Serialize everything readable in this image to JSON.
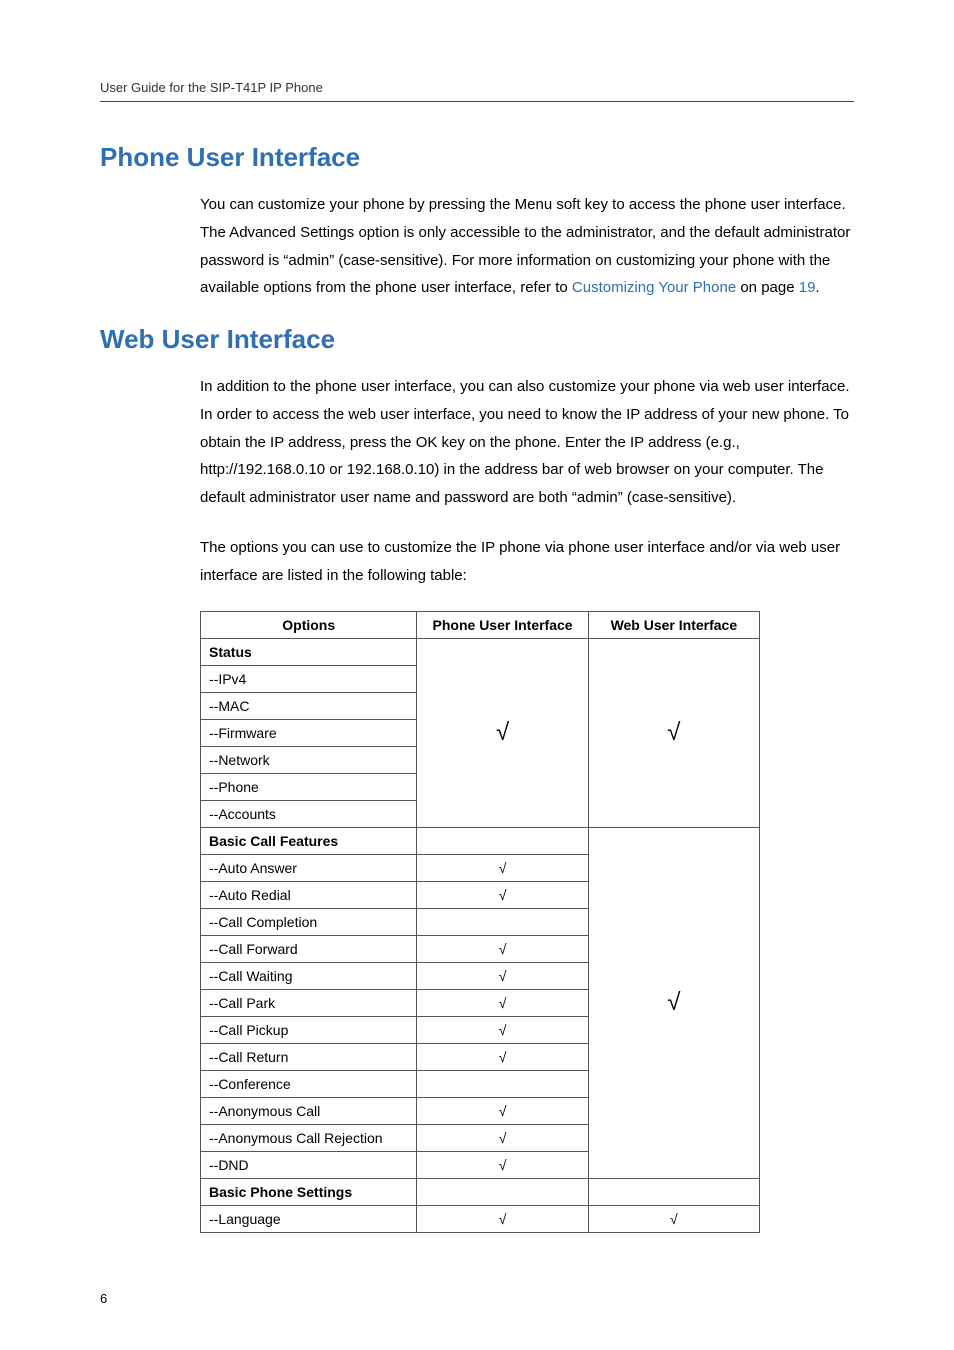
{
  "running_head": "User Guide for the SIP-T41P IP Phone",
  "page_number": "6",
  "sections": {
    "phone_ui": {
      "heading": "Phone User Interface",
      "para": "You can customize your phone by pressing the Menu soft key to access the phone user interface. The Advanced Settings option is only accessible to the administrator, and the default administrator password is “admin” (case-sensitive). For more information on customizing your phone with the available options from the phone user interface, refer to ",
      "link_text": "Customizing Your Phone",
      "para_mid": " on page ",
      "page_ref": "19",
      "para_end": "."
    },
    "web_ui": {
      "heading": "Web User Interface",
      "para1": "In addition to the phone user interface, you can also customize your phone via web user interface. In order to access the web user interface, you need to know the IP address of your new phone. To obtain the IP address, press the OK key on the phone. Enter the IP address (e.g., http://192.168.0.10 or 192.168.0.10) in the address bar of web browser on your computer. The default administrator user name and password are both “admin” (case-sensitive).",
      "para2": "The options you can use to customize the IP phone via phone user interface and/or via web user interface are listed in the following table:"
    }
  },
  "table": {
    "headers": {
      "options": "Options",
      "pui": "Phone User Interface",
      "wui": "Web User Interface"
    },
    "check": "√",
    "rows": {
      "status_header": "Status",
      "ipv4": "--IPv4",
      "mac": "--MAC",
      "firmware": "--Firmware",
      "network": "--Network",
      "phone": "--Phone",
      "accounts": "--Accounts",
      "bcf_header": "Basic Call Features",
      "auto_answer": "--Auto Answer",
      "auto_redial": "--Auto Redial",
      "call_completion": "--Call Completion",
      "call_forward": "--Call Forward",
      "call_waiting": "--Call Waiting",
      "call_park": "--Call Park",
      "call_pickup": "--Call Pickup",
      "call_return": "--Call Return",
      "conference": "--Conference",
      "anon_call": "--Anonymous Call",
      "anon_rej": "--Anonymous Call Rejection",
      "dnd": "--DND",
      "bps_header": "Basic Phone Settings",
      "language": "--Language"
    }
  }
}
